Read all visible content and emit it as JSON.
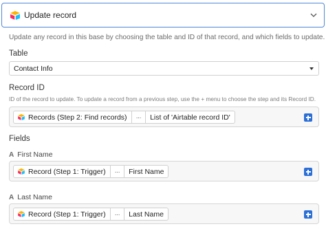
{
  "header": {
    "title": "Update record",
    "logo_icon": "airtable-logo-icon",
    "chevron_icon": "chevron-down-icon"
  },
  "description": "Update any record in this base by choosing the table and ID of that record, and which fields to update.",
  "table": {
    "label": "Table",
    "selected": "Contact Info"
  },
  "record_id": {
    "label": "Record ID",
    "help": "ID of the record to update. To update a record from a previous step, use the + menu to choose the step and its Record ID.",
    "token": {
      "step": "Records (Step 2: Find records)",
      "menu": "···",
      "value": "List of 'Airtable record ID'"
    }
  },
  "fields": {
    "label": "Fields",
    "items": [
      {
        "name": "First Name",
        "token": {
          "step": "Record (Step 1: Trigger)",
          "menu": "···",
          "value": "First Name"
        }
      },
      {
        "name": "Last Name",
        "token": {
          "step": "Record (Step 1: Trigger)",
          "menu": "···",
          "value": "Last Name"
        }
      }
    ],
    "field_icon": "A"
  },
  "colors": {
    "accent": "#2b6fd6",
    "header_border": "#4f87d6"
  }
}
